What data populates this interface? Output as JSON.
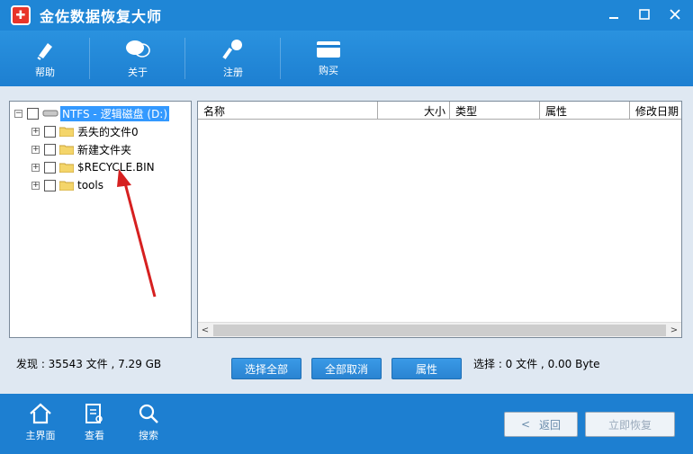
{
  "window": {
    "title": "金佐数据恢复大师"
  },
  "toolbar": {
    "items": [
      {
        "label": "帮助",
        "icon": "pen-icon"
      },
      {
        "label": "关于",
        "icon": "chat-icon"
      },
      {
        "label": "注册",
        "icon": "key-icon"
      },
      {
        "label": "购买",
        "icon": "card-icon"
      }
    ]
  },
  "tree": {
    "root": {
      "label": "NTFS - 逻辑磁盘 (D:)"
    },
    "items": [
      {
        "label": "丢失的文件0"
      },
      {
        "label": "新建文件夹"
      },
      {
        "label": "$RECYCLE.BIN"
      },
      {
        "label": "tools"
      }
    ]
  },
  "list": {
    "columns": [
      "名称",
      "大小",
      "类型",
      "属性",
      "修改日期"
    ]
  },
  "status": {
    "found": "发现 : 35543 文件 , 7.29 GB",
    "selected": "选择 : 0 文件 , 0.00 Byte"
  },
  "actions": {
    "select_all": "选择全部",
    "deselect_all": "全部取消",
    "properties": "属性"
  },
  "bottom": {
    "nav": [
      {
        "label": "主界面",
        "icon": "home-icon"
      },
      {
        "label": "查看",
        "icon": "document-icon"
      },
      {
        "label": "搜索",
        "icon": "search-icon"
      }
    ],
    "back": "返回",
    "recover": "立即恢复"
  },
  "colors": {
    "primary": "#1d7fd1",
    "selection": "#3399ff",
    "annotation_arrow": "#d62020"
  }
}
